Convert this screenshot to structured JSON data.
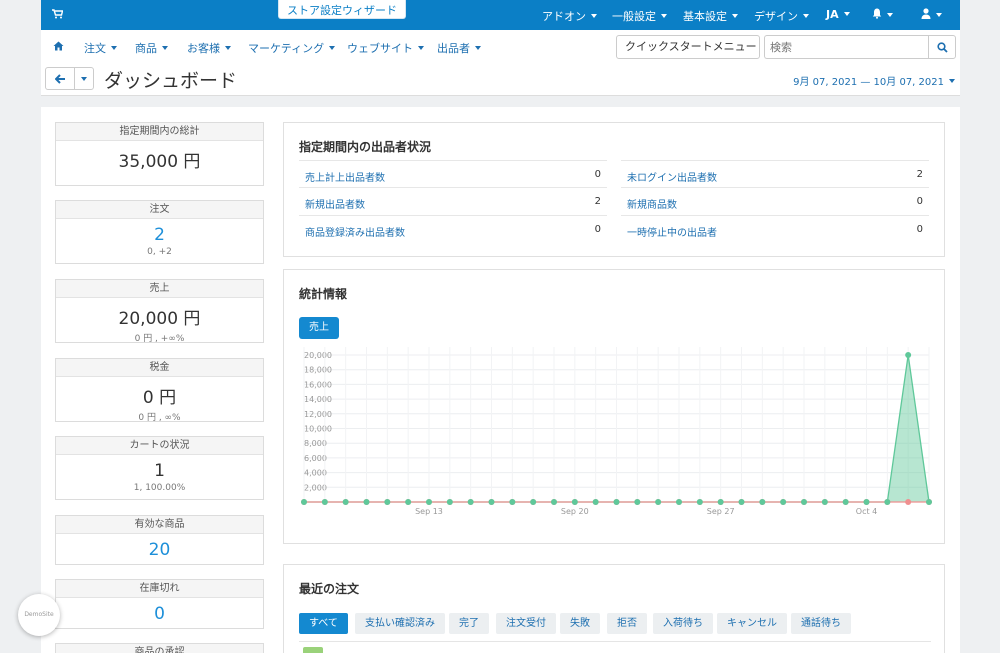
{
  "topbar": {
    "wizard": "ストア設定ウィザード",
    "menus": [
      "アドオン",
      "一般設定",
      "基本設定",
      "デザイン",
      "JA"
    ]
  },
  "nav": {
    "items": [
      "注文",
      "商品",
      "お客様",
      "マーケティング",
      "ウェブサイト",
      "出品者"
    ],
    "quickstart": "クイックスタートメニュー",
    "search_placeholder": "検索"
  },
  "page": {
    "title": "ダッシュボード",
    "date_range": "9月 07, 2021 — 10月 07, 2021"
  },
  "stats": [
    {
      "label": "指定期間内の総計",
      "value": "35,000 円",
      "sub": ""
    },
    {
      "label": "注文",
      "value": "2",
      "sub": "0, +2"
    },
    {
      "label": "売上",
      "value": "20,000 円",
      "sub": "0 円 , +∞%"
    },
    {
      "label": "税金",
      "value": "0 円",
      "sub": "0 円 , ∞%"
    },
    {
      "label": "カートの状況",
      "value": "1",
      "sub": "1, 100.00%"
    },
    {
      "label": "有効な商品",
      "value": "20",
      "sub": ""
    },
    {
      "label": "在庫切れ",
      "value": "0",
      "sub": ""
    },
    {
      "label": "商品の承認",
      "value": "",
      "sub": ""
    }
  ],
  "vendors": {
    "title": "指定期間内の出品者状況",
    "rows": [
      {
        "label": "売上計上出品者数",
        "value": "0"
      },
      {
        "label": "未ログイン出品者数",
        "value": "2"
      },
      {
        "label": "新規出品者数",
        "value": "2"
      },
      {
        "label": "新規商品数",
        "value": "0"
      },
      {
        "label": "商品登録済み出品者数",
        "value": "0"
      },
      {
        "label": "一時停止中の出品者",
        "value": "0"
      }
    ]
  },
  "stats_panel": {
    "title": "統計情報",
    "button": "売上"
  },
  "chart_data": {
    "type": "area",
    "y_ticks": [
      "20,000",
      "18,000",
      "16,000",
      "14,000",
      "12,000",
      "10,000",
      "8,000",
      "6,000",
      "4,000",
      "2,000"
    ],
    "x_ticks": [
      "Sep 13",
      "Sep 20",
      "Sep 27",
      "Oct 4"
    ],
    "ylim": [
      0,
      20000
    ],
    "x": [
      "Sep 7",
      "Sep 8",
      "Sep 9",
      "Sep 10",
      "Sep 11",
      "Sep 12",
      "Sep 13",
      "Sep 14",
      "Sep 15",
      "Sep 16",
      "Sep 17",
      "Sep 18",
      "Sep 19",
      "Sep 20",
      "Sep 21",
      "Sep 22",
      "Sep 23",
      "Sep 24",
      "Sep 25",
      "Sep 26",
      "Sep 27",
      "Sep 28",
      "Sep 29",
      "Sep 30",
      "Oct 1",
      "Oct 2",
      "Oct 3",
      "Oct 4",
      "Oct 5",
      "Oct 6",
      "Oct 7"
    ],
    "series": [
      {
        "color": "#5fc89a",
        "values": [
          0,
          0,
          0,
          0,
          0,
          0,
          0,
          0,
          0,
          0,
          0,
          0,
          0,
          0,
          0,
          0,
          0,
          0,
          0,
          0,
          0,
          0,
          0,
          0,
          0,
          0,
          0,
          0,
          0,
          20000,
          0
        ]
      },
      {
        "color": "#ef8f8f",
        "values": [
          0,
          0,
          0,
          0,
          0,
          0,
          0,
          0,
          0,
          0,
          0,
          0,
          0,
          0,
          0,
          0,
          0,
          0,
          0,
          0,
          0,
          0,
          0,
          0,
          0,
          0,
          0,
          0,
          0,
          0,
          0
        ]
      }
    ],
    "grid": true
  },
  "orders": {
    "title": "最近の注文",
    "tabs": [
      "すべて",
      "支払い確認済み",
      "完了",
      "注文受付",
      "失敗",
      "拒否",
      "入荷待ち",
      "キャンセル",
      "通話待ち"
    ]
  },
  "demo_badge": "DemoSite"
}
